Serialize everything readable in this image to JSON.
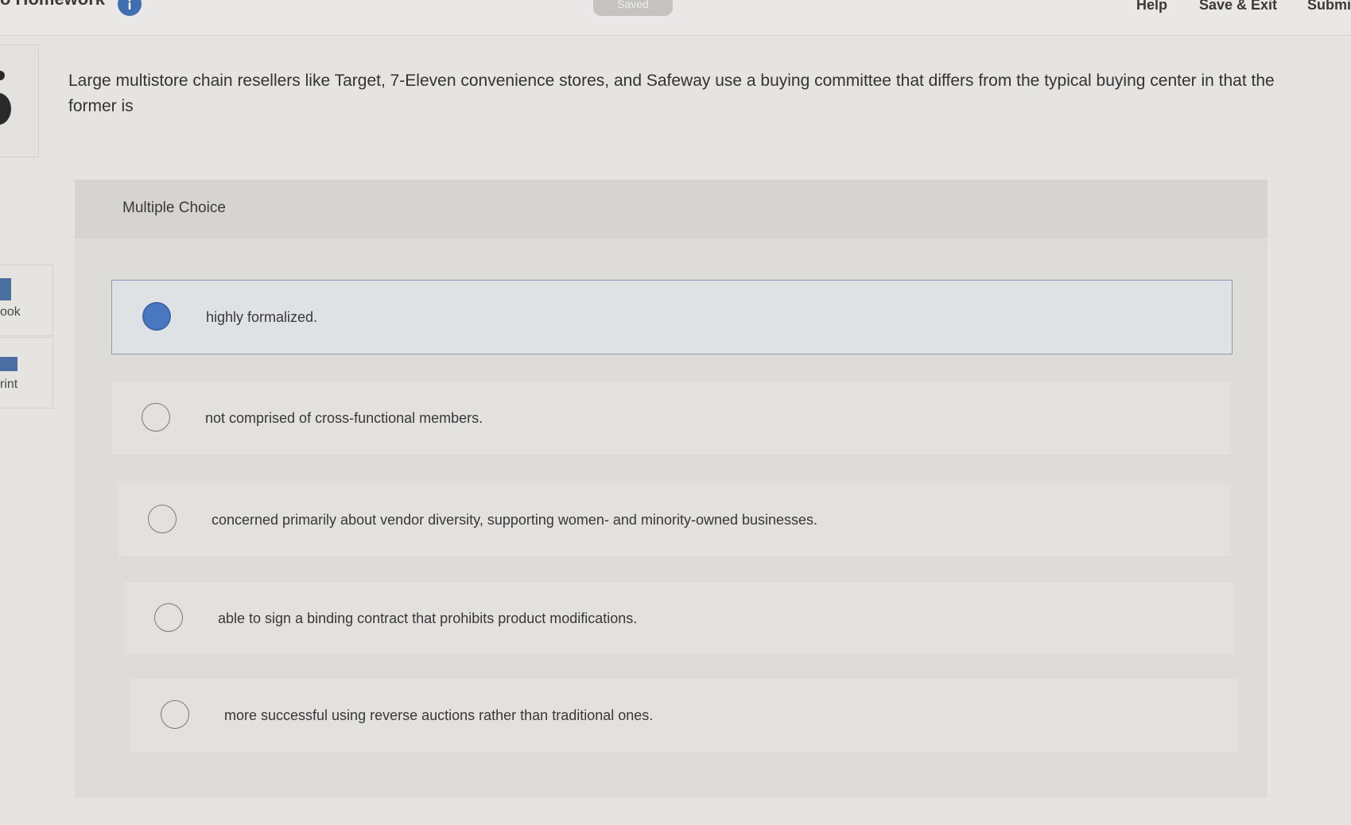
{
  "header": {
    "title": "o Homework",
    "info_badge": "i",
    "saved_label": "Saved",
    "help_label": "Help",
    "save_exit_label": "Save & Exit",
    "submit_label": "Submit"
  },
  "sidebar": {
    "tools": [
      {
        "label": "ook",
        "icon": "ebook-icon"
      },
      {
        "label": "rint",
        "icon": "print-icon"
      }
    ]
  },
  "question": {
    "text": "Large multistore chain resellers like Target, 7-Eleven convenience stores, and Safeway use a buying committee that differs from the typical buying center in that the former is"
  },
  "answer_section": {
    "type_label": "Multiple Choice",
    "options": [
      {
        "text": "highly formalized.",
        "selected": true
      },
      {
        "text": "not comprised of cross-functional members.",
        "selected": false
      },
      {
        "text": "concerned primarily about vendor diversity, supporting women- and minority-owned businesses.",
        "selected": false
      },
      {
        "text": "able to sign a binding contract that prohibits product modifications.",
        "selected": false
      },
      {
        "text": "more successful using reverse auctions rather than traditional ones.",
        "selected": false
      }
    ]
  },
  "colors": {
    "selected_radio": "#4a78c0",
    "accent": "#3f6fb0",
    "page_background": "#e6e4e1"
  }
}
